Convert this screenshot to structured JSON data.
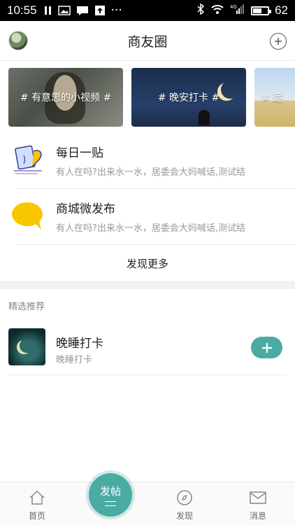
{
  "status_bar": {
    "time": "10:55",
    "overflow_dots": "···",
    "battery_level": "62",
    "battery_fraction": 0.62,
    "network_label": "4G"
  },
  "header": {
    "title": "商友圈"
  },
  "topic_cards": [
    {
      "label": "# 有意思的小视频 #"
    },
    {
      "label": "# 晚安打卡 #"
    },
    {
      "label": "# 运"
    }
  ],
  "features": [
    {
      "title": "每日一贴",
      "desc": "有人在吗?出来水一水，居委会大妈喊话,测试结"
    },
    {
      "title": "商城微发布",
      "desc": "有人在吗?出来水一水，居委会大妈喊话,测试结"
    }
  ],
  "more_label": "发现更多",
  "section_title": "精选推荐",
  "recommendation": {
    "title": "晚睡打卡",
    "subtitle": "晚睡打卡"
  },
  "tabbar": {
    "home": "首页",
    "post": "发帖",
    "discover": "发现",
    "messages": "消息"
  },
  "colors": {
    "accent": "#4aaba3",
    "bubble_yellow": "#f7c600"
  }
}
